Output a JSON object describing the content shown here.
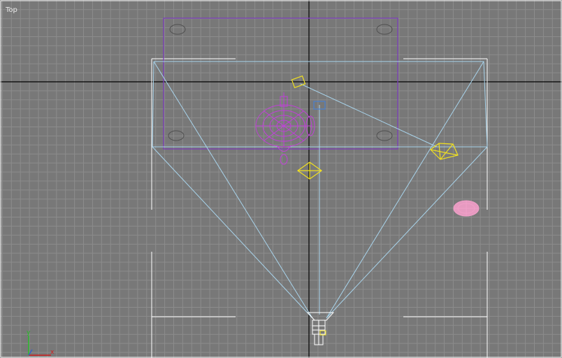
{
  "viewport": {
    "label": "Top",
    "background_color": "#787878",
    "grid_color": "#8c8c8c",
    "axis_line_color": "#000000",
    "active_border_color": "#ffffff"
  },
  "axis_tripod": {
    "x_label": "x",
    "y_label": "y",
    "x_color": "#d02020",
    "y_color": "#22c022"
  },
  "scene_objects": {
    "table_plane": {
      "color": "#7b3fb8",
      "selected": false
    },
    "box_frame": {
      "color": "#ffffff"
    },
    "camera_frustum": {
      "color": "#a8d4ec"
    },
    "teapot": {
      "color": "#c040d8"
    },
    "target_camera": {
      "color": "#f0e020"
    },
    "omni_light": {
      "color": "#f0e020"
    },
    "spot_light": {
      "color": "#f0e020"
    },
    "sphere": {
      "color": "#f0a0c8"
    },
    "camera_target": {
      "color": "#4a80d0"
    }
  }
}
